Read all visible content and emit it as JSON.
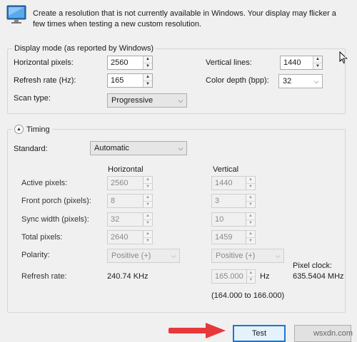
{
  "intro": {
    "icon": "monitor-icon",
    "text": "Create a resolution that is not currently available in Windows. Your display may flicker a few times when testing a new custom resolution."
  },
  "display_mode": {
    "legend": "Display mode (as reported by Windows)",
    "horizontal_pixels_label": "Horizontal pixels:",
    "horizontal_pixels_value": "2560",
    "vertical_lines_label": "Vertical lines:",
    "vertical_lines_value": "1440",
    "refresh_rate_label": "Refresh rate (Hz):",
    "refresh_rate_value": "165",
    "color_depth_label": "Color depth (bpp):",
    "color_depth_value": "32",
    "scan_type_label": "Scan type:",
    "scan_type_value": "Progressive"
  },
  "timing": {
    "legend": "Timing",
    "standard_label": "Standard:",
    "standard_value": "Automatic",
    "horizontal_header": "Horizontal",
    "vertical_header": "Vertical",
    "rows": {
      "active": {
        "label": "Active pixels:",
        "h": "2560",
        "v": "1440"
      },
      "front_porch": {
        "label": "Front porch (pixels):",
        "h": "8",
        "v": "3"
      },
      "sync_width": {
        "label": "Sync width (pixels):",
        "h": "32",
        "v": "10"
      },
      "total": {
        "label": "Total pixels:",
        "h": "2640",
        "v": "1459"
      }
    },
    "polarity_label": "Polarity:",
    "polarity_h": "Positive (+)",
    "polarity_v": "Positive (+)",
    "refresh_rate_label": "Refresh rate:",
    "refresh_rate_h": "240.74 KHz",
    "refresh_rate_v": "165.000",
    "refresh_rate_unit": "Hz",
    "refresh_rate_range": "(164.000 to 166.000)",
    "pixel_clock_label": "Pixel clock:",
    "pixel_clock_value": "635.5404 MHz"
  },
  "buttons": {
    "test_label": "Test"
  },
  "watermark": "wsxdn.com",
  "colors": {
    "accent": "#1a76d2",
    "arrow": "#e8383b"
  }
}
